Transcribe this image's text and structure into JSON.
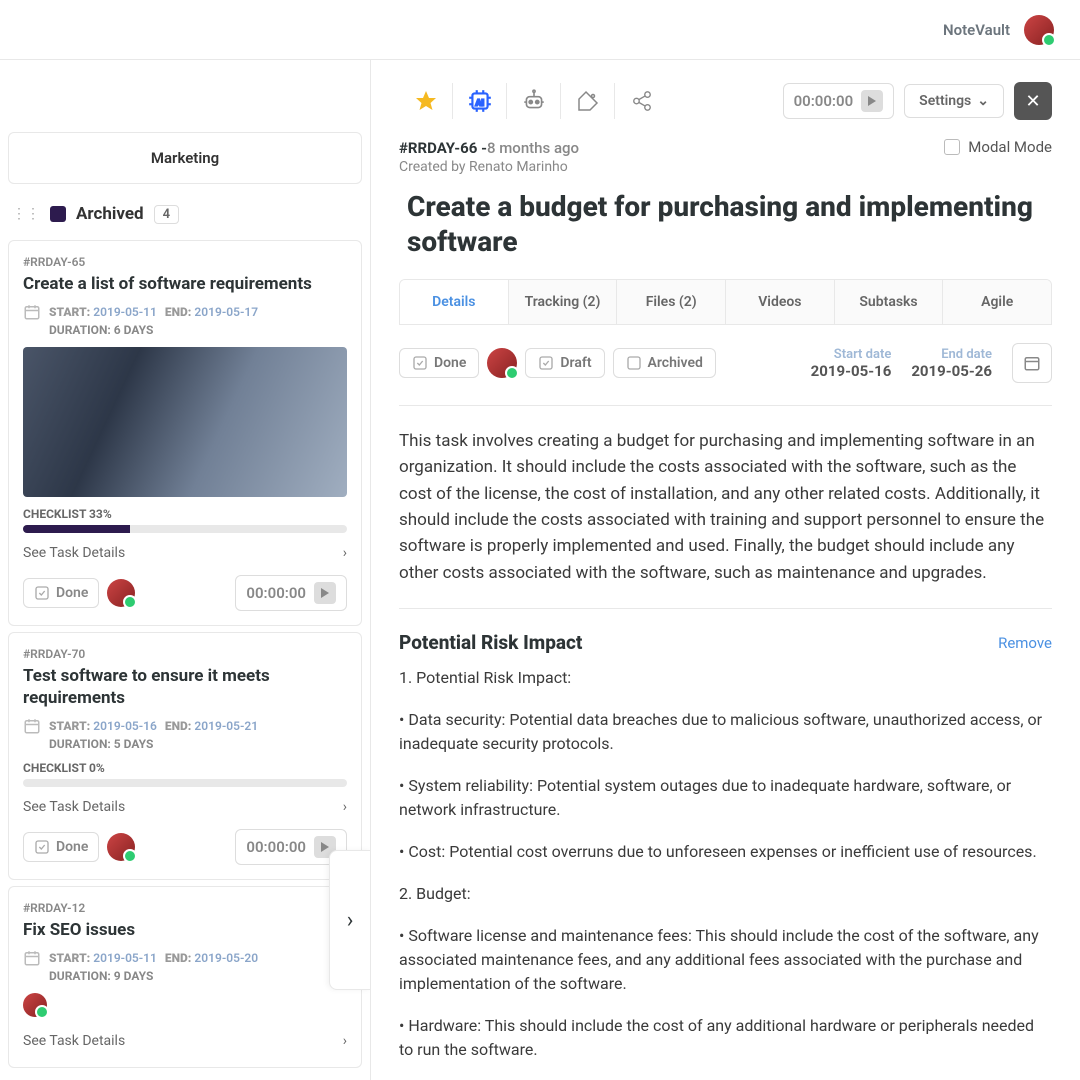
{
  "header": {
    "brand": "NoteVault"
  },
  "board": {
    "title": "Marketing"
  },
  "column": {
    "name": "Archived",
    "count": "4"
  },
  "cards": [
    {
      "id": "#RRDAY-65",
      "title": "Create a list of software requirements",
      "start_label": "START:",
      "start": "2019-05-11",
      "end_label": "END:",
      "end": "2019-05-17",
      "duration": "DURATION: 6 DAYS",
      "checklist": "CHECKLIST 33%",
      "progress": 33,
      "see_details": "See Task Details",
      "done": "Done",
      "timer": "00:00:00",
      "has_image": true
    },
    {
      "id": "#RRDAY-70",
      "title": "Test software to ensure it meets requirements",
      "start_label": "START:",
      "start": "2019-05-16",
      "end_label": "END:",
      "end": "2019-05-21",
      "duration": "DURATION: 5 DAYS",
      "checklist": "CHECKLIST 0%",
      "progress": 0,
      "see_details": "See Task Details",
      "done": "Done",
      "timer": "00:00:00",
      "has_image": false
    },
    {
      "id": "#RRDAY-12",
      "title": "Fix SEO issues",
      "start_label": "START:",
      "start": "2019-05-11",
      "end_label": "END:",
      "end": "2019-05-20",
      "duration": "DURATION: 9 DAYS",
      "see_details": "See Task Details"
    }
  ],
  "detail": {
    "timer": "00:00:00",
    "settings": "Settings",
    "id": "#RRDAY-66 -",
    "age": "8 months ago",
    "created_by_label": "Created by ",
    "created_by": "Renato Marinho",
    "modal_mode": "Modal Mode",
    "title": "Create a budget for purchasing and implementing software",
    "tabs": [
      "Details",
      "Tracking (2)",
      "Files (2)",
      "Videos",
      "Subtasks",
      "Agile"
    ],
    "done": "Done",
    "draft": "Draft",
    "archived": "Archived",
    "start_label": "Start date",
    "start": "2019-05-16",
    "end_label": "End date",
    "end": "2019-05-26",
    "description": "This task involves creating a budget for purchasing and implementing software in an organization. It should include the costs associated with the software, such as the cost of the license, the cost of installation, and any other related costs. Additionally, it should include the costs associated with training and support personnel to ensure the software is properly implemented and used. Finally, the budget should include any other costs associated with the software, such as maintenance and upgrades.",
    "risk_title": "Potential Risk Impact",
    "remove": "Remove",
    "risk_body": [
      "1. Potential Risk Impact:",
      "• Data security: Potential data breaches due to malicious software, unauthorized access, or inadequate security protocols.",
      "• System reliability: Potential system outages due to inadequate hardware, software, or network infrastructure.",
      "• Cost: Potential cost overruns due to unforeseen expenses or inefficient use of resources.",
      "2. Budget:",
      "• Software license and maintenance fees: This should include the cost of the software, any associated maintenance fees, and any additional fees associated with the purchase and implementation of the software.",
      "• Hardware: This should include the cost of any additional hardware or peripherals needed to run the software."
    ]
  }
}
